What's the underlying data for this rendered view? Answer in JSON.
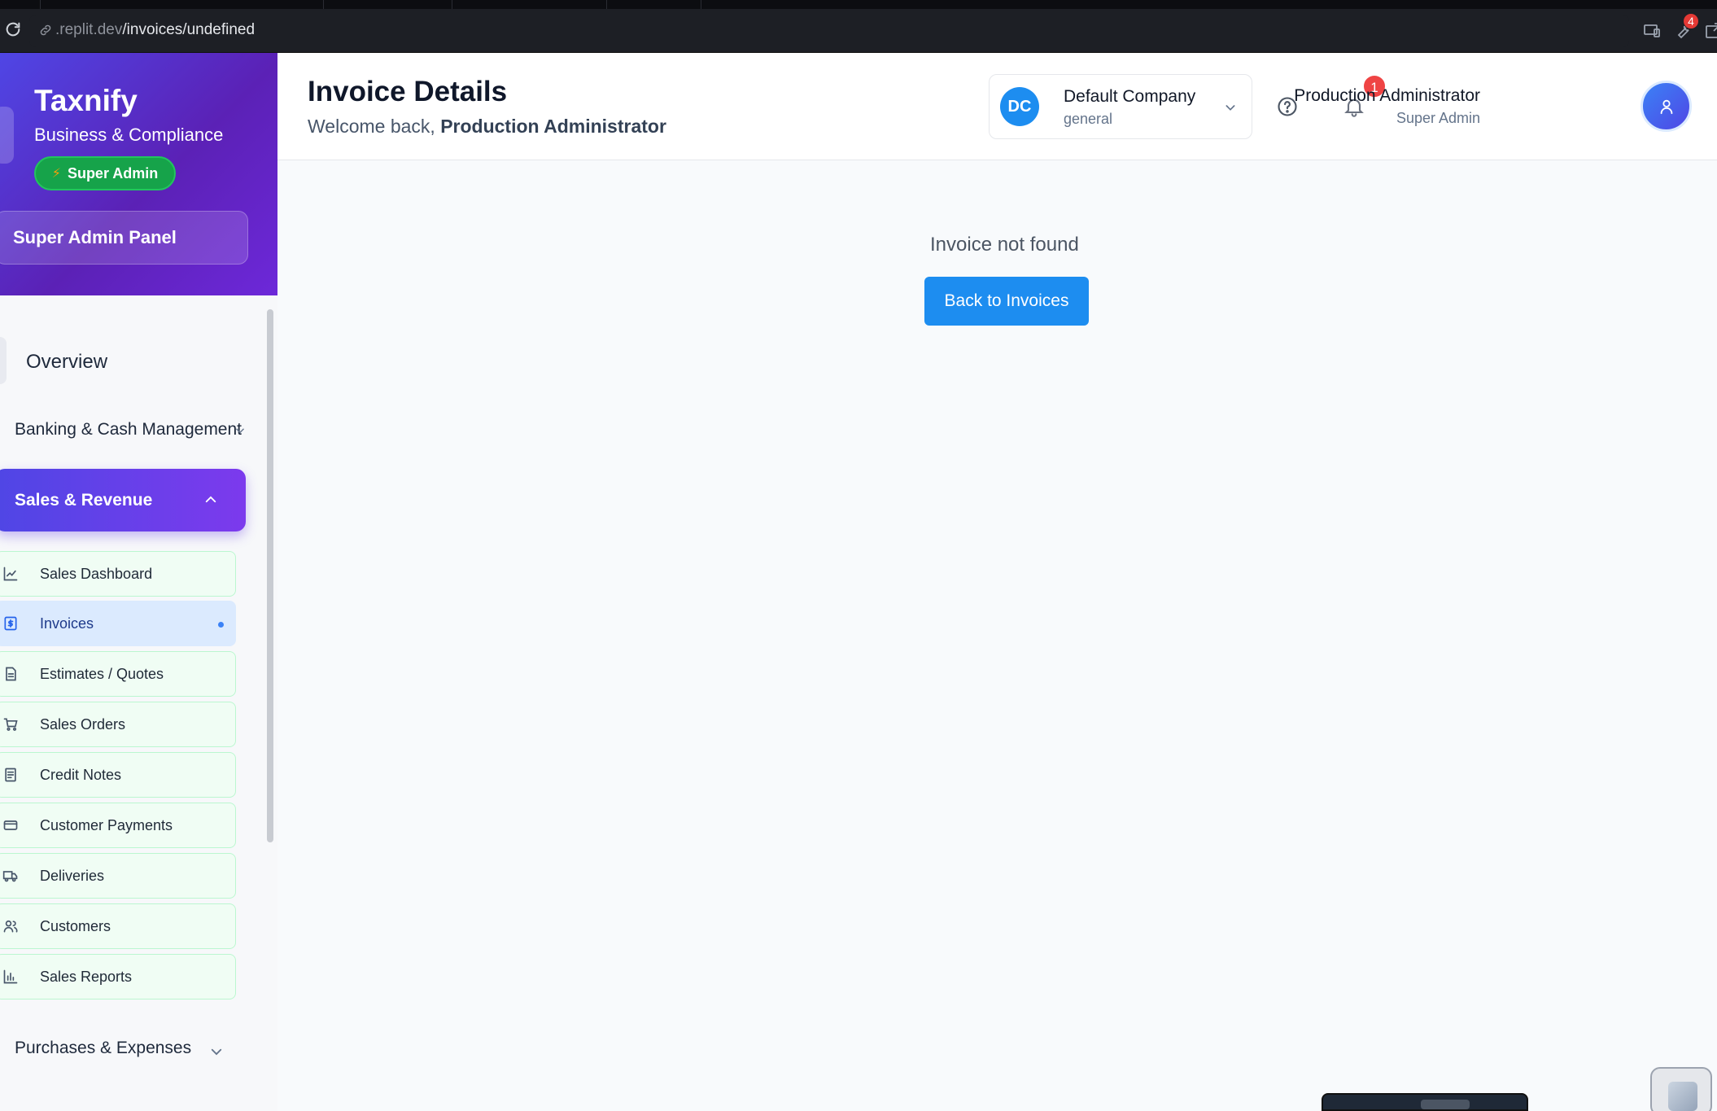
{
  "browser": {
    "url_prefix": ".replit.dev",
    "url_path": "/invoices/undefined",
    "extension_badge": "4"
  },
  "brand": {
    "title": "Taxnify",
    "subtitle": "Business & Compliance",
    "role_pill": "Super Admin",
    "panel_button": "Super Admin Panel"
  },
  "nav": {
    "overview": "Overview",
    "banking": "Banking & Cash Management",
    "sales": "Sales & Revenue",
    "purchases": "Purchases & Expenses",
    "sales_items": [
      {
        "label": "Sales Dashboard",
        "icon": "chart-line-icon"
      },
      {
        "label": "Invoices",
        "icon": "invoice-dollar-icon",
        "active": true
      },
      {
        "label": "Estimates / Quotes",
        "icon": "document-icon"
      },
      {
        "label": "Sales Orders",
        "icon": "cart-icon"
      },
      {
        "label": "Credit Notes",
        "icon": "receipt-icon"
      },
      {
        "label": "Customer Payments",
        "icon": "credit-card-icon"
      },
      {
        "label": "Deliveries",
        "icon": "truck-icon"
      },
      {
        "label": "Customers",
        "icon": "users-icon"
      },
      {
        "label": "Sales Reports",
        "icon": "bar-chart-icon"
      }
    ]
  },
  "header": {
    "title": "Invoice Details",
    "welcome_prefix": "Welcome back,",
    "welcome_name": "Production Administrator",
    "company_initials": "DC",
    "company_name": "Default Company",
    "company_type": "general",
    "notification_count": "1",
    "user_name": "Production Administrator",
    "user_role": "Super Admin"
  },
  "main": {
    "message": "Invoice not found",
    "back_button": "Back to Invoices"
  },
  "colors": {
    "accent_blue": "#1d8df0",
    "brand_gradient_start": "#4f46e5",
    "brand_gradient_end": "#6d28d9",
    "pill_green": "#16a34a",
    "badge_red": "#ef4444"
  }
}
